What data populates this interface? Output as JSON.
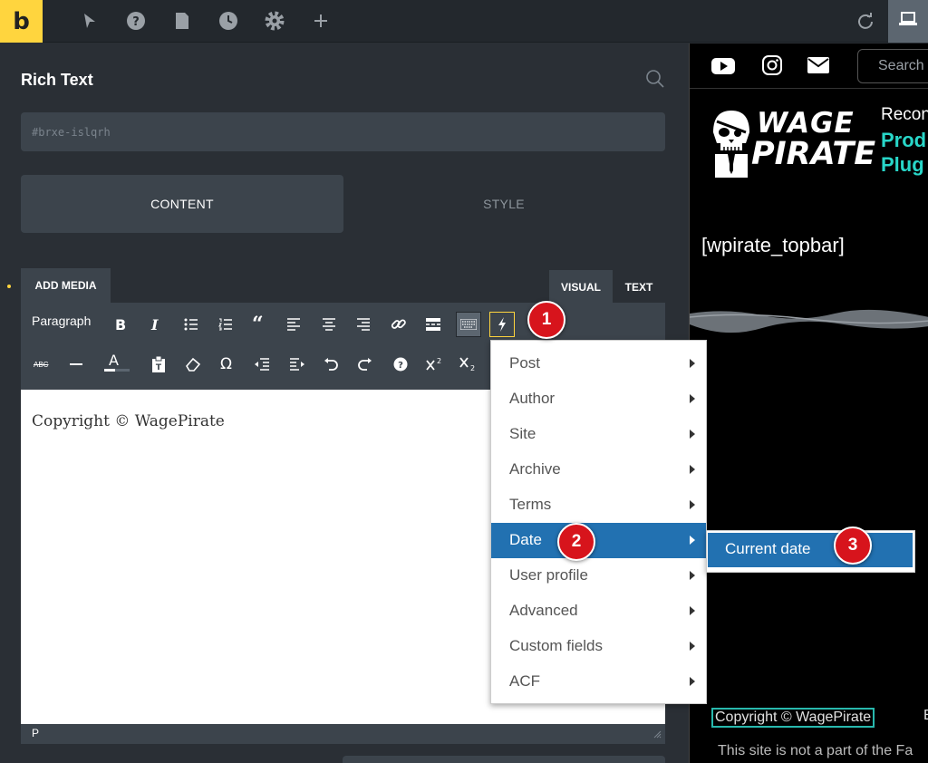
{
  "topbar": {
    "logo": "b",
    "icons": [
      "pointer-icon",
      "help-icon",
      "page-icon",
      "history-icon",
      "settings-icon",
      "add-icon",
      "undo-icon",
      "laptop-icon"
    ]
  },
  "panel": {
    "title": "Rich Text",
    "css_id": "#brxe-islqrh",
    "tabs": [
      "CONTENT",
      "STYLE"
    ]
  },
  "editor": {
    "add_media": "ADD MEDIA",
    "mode_tabs": [
      "VISUAL",
      "TEXT"
    ],
    "format": "Paragraph",
    "toolbar_row1": [
      "bold-icon",
      "italic-icon",
      "bullet-list-icon",
      "numbered-list-icon",
      "blockquote-icon",
      "align-left-icon",
      "align-center-icon",
      "align-right-icon",
      "link-icon",
      "read-more-icon",
      "toolbar-toggle-icon",
      "dynamic-data-icon"
    ],
    "toolbar_row2": [
      "strikethrough-icon",
      "horizontal-line-icon",
      "text-color-icon",
      "paste-text-icon",
      "clear-formatting-icon",
      "special-char-icon",
      "outdent-icon",
      "indent-icon",
      "undo-icon",
      "redo-icon",
      "help-icon",
      "superscript-icon",
      "subscript-icon"
    ],
    "content": "Copyright ©  WagePirate",
    "status": "P"
  },
  "dropdown": {
    "items": [
      "Post",
      "Author",
      "Site",
      "Archive",
      "Terms",
      "Date",
      "User profile",
      "Advanced",
      "Custom fields",
      "ACF"
    ],
    "highlighted": "Date",
    "submenu": "Current date"
  },
  "preview": {
    "search_placeholder": "Search",
    "brand_top": "WAGE",
    "brand_bottom": "PIRATE",
    "tagline1": "Recon",
    "tagline2": "Prod",
    "tagline3": "Plug",
    "shortcode": "[wpirate_topbar]",
    "copyright": "Copyright ©  WagePirate",
    "copyright_tail": "E",
    "notice": "This site is not a part of the Fa"
  },
  "badges": [
    "1",
    "2",
    "3"
  ],
  "colors": {
    "accent": "#ffd53e",
    "highlight": "#2271b1",
    "badge": "#d7141c",
    "teal": "#28d6c8"
  }
}
